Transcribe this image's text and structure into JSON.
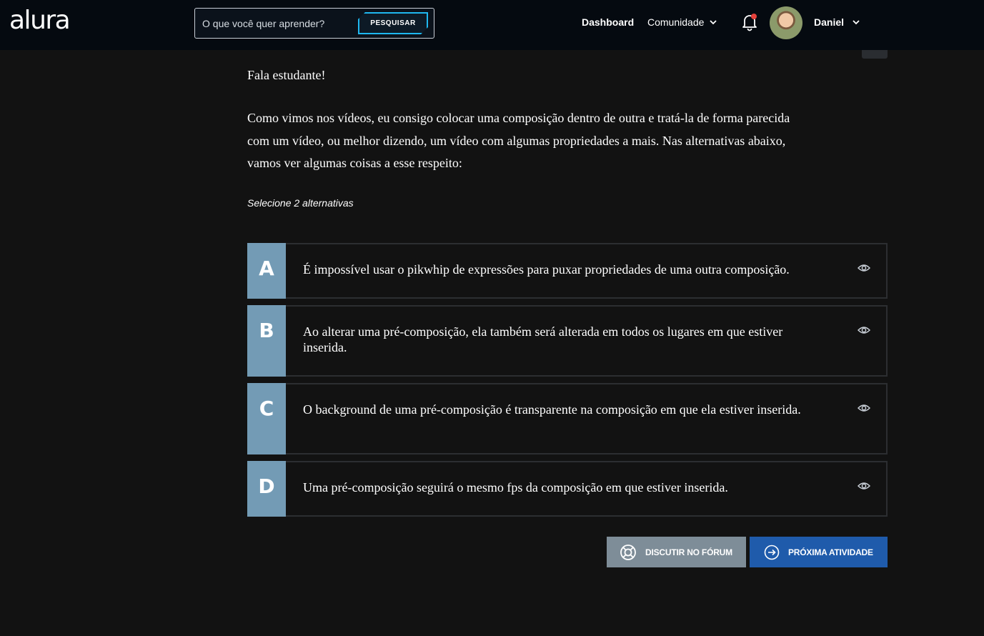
{
  "header": {
    "logo": "alura",
    "search_placeholder": "O que você quer aprender?",
    "search_button": "PESQUISAR",
    "nav_dashboard": "Dashboard",
    "nav_community": "Comunidade",
    "user_name": "Daniel"
  },
  "activity": {
    "greeting": "Fala estudante!",
    "body": "Como vimos nos vídeos, eu consigo colocar uma composição dentro de outra e tratá-la de forma parecida com um vídeo, ou melhor dizendo, um vídeo com algumas propriedades a mais. Nas alternativas abaixo, vamos ver algumas coisas a esse respeito:",
    "hint": "Selecione 2 alternativas",
    "alternatives": [
      {
        "letter": "A",
        "text": "É impossível usar o pikwhip de expressões para puxar propriedades de uma outra composição."
      },
      {
        "letter": "B",
        "text": "Ao alterar uma pré-composição, ela também será alterada em todos os lugares em que estiver inserida."
      },
      {
        "letter": "C",
        "text": "O background de uma pré-composição é transparente na composição em que ela estiver inserida."
      },
      {
        "letter": "D",
        "text": "Uma pré-composição seguirá o mesmo fps da composição em que estiver inserida."
      }
    ]
  },
  "actions": {
    "forum_label": "DISCUTIR NO FÓRUM",
    "next_label": "PRÓXIMA ATIVIDADE"
  },
  "colors": {
    "header_bg": "#050a10",
    "page_bg": "#121212",
    "letter_bg": "#739bb5",
    "search_accent": "#1fb8f0",
    "forum_btn": "#7e8d98",
    "next_btn": "#1f5bab",
    "notification_dot": "#e5413b"
  }
}
